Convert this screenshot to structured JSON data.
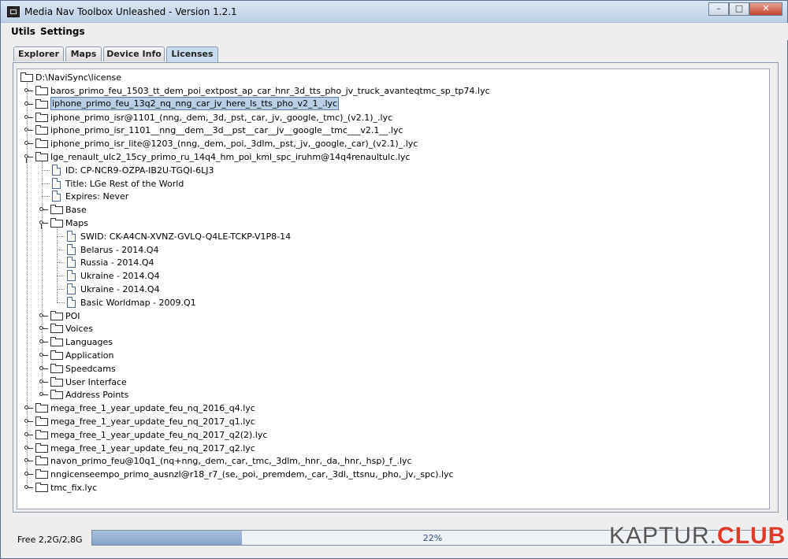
{
  "window": {
    "title": "Media Nav Toolbox Unleashed - Version 1.2.1",
    "controls": {
      "minimize": "–",
      "maximize": "□",
      "close": "✕"
    }
  },
  "menu": {
    "items": [
      "Utils",
      "Settings"
    ]
  },
  "tabs": {
    "items": [
      "Explorer",
      "Maps",
      "Device Info",
      "Licenses"
    ],
    "active": "Licenses"
  },
  "tree": {
    "root": "D:\\NaviSync\\license",
    "rows": [
      {
        "label": "baros_primo_feu_1503_tt_dem_poi_extpost_ap_car_hnr_3d_tts_pho_jv_truck_avanteqtmc_sp_tp74.lyc",
        "depth": 1,
        "icon": "folder",
        "state": "closed"
      },
      {
        "label": "iphone_primo_feu_13q2_nq_nng_car_jv_here_ls_tts_pho_v2_1_.lyc",
        "depth": 1,
        "icon": "folder",
        "state": "closed",
        "selected": true
      },
      {
        "label": "iphone_primo_isr@1101_(nng,_dem,_3d,_pst,_car,_jv,_google,_tmc)_(v2.1)_.lyc",
        "depth": 1,
        "icon": "folder",
        "state": "closed"
      },
      {
        "label": "iphone_primo_isr_1101__nng__dem__3d__pst__car__jv__google__tmc___v2.1__.lyc",
        "depth": 1,
        "icon": "folder",
        "state": "closed"
      },
      {
        "label": "iphone_primo_isr_lite@1203_(nng,_dem,_poi,_3dlm,_pst,_jv,_google,_car)_(v2.1)_.lyc",
        "depth": 1,
        "icon": "folder",
        "state": "closed"
      },
      {
        "label": "lge_renault_ulc2_15cy_primo_ru_14q4_hm_poi_kml_spc_iruhm@14q4renaultulc.lyc",
        "depth": 1,
        "icon": "folder",
        "state": "open"
      },
      {
        "label": "ID: CP-NCR9-OZPA-IB2U-TGQI-6LJ3",
        "depth": 2,
        "icon": "file"
      },
      {
        "label": "Title: LGe Rest of the World",
        "depth": 2,
        "icon": "file"
      },
      {
        "label": "Expires: Never",
        "depth": 2,
        "icon": "file"
      },
      {
        "label": "Base",
        "depth": 2,
        "icon": "folder",
        "state": "closed"
      },
      {
        "label": "Maps",
        "depth": 2,
        "icon": "folder",
        "state": "open"
      },
      {
        "label": "SWID: CK-A4CN-XVNZ-GVLQ-Q4LE-TCKP-V1P8-14",
        "depth": 3,
        "icon": "file"
      },
      {
        "label": "Belarus - 2014.Q4",
        "depth": 3,
        "icon": "file"
      },
      {
        "label": "Russia - 2014.Q4",
        "depth": 3,
        "icon": "file"
      },
      {
        "label": "Ukraine - 2014.Q4",
        "depth": 3,
        "icon": "file"
      },
      {
        "label": "Ukraine - 2014.Q4",
        "depth": 3,
        "icon": "file"
      },
      {
        "label": "Basic Worldmap - 2009.Q1",
        "depth": 3,
        "icon": "file"
      },
      {
        "label": "POI",
        "depth": 2,
        "icon": "folder",
        "state": "closed"
      },
      {
        "label": "Voices",
        "depth": 2,
        "icon": "folder",
        "state": "closed"
      },
      {
        "label": "Languages",
        "depth": 2,
        "icon": "folder",
        "state": "closed"
      },
      {
        "label": "Application",
        "depth": 2,
        "icon": "folder",
        "state": "closed"
      },
      {
        "label": "Speedcams",
        "depth": 2,
        "icon": "folder",
        "state": "closed"
      },
      {
        "label": "User Interface",
        "depth": 2,
        "icon": "folder",
        "state": "closed"
      },
      {
        "label": "Address Points",
        "depth": 2,
        "icon": "folder",
        "state": "closed"
      },
      {
        "label": "mega_free_1_year_update_feu_nq_2016_q4.lyc",
        "depth": 1,
        "icon": "folder",
        "state": "closed"
      },
      {
        "label": "mega_free_1_year_update_feu_nq_2017_q1.lyc",
        "depth": 1,
        "icon": "folder",
        "state": "closed"
      },
      {
        "label": "mega_free_1_year_update_feu_nq_2017_q2(2).lyc",
        "depth": 1,
        "icon": "folder",
        "state": "closed"
      },
      {
        "label": "mega_free_1_year_update_feu_nq_2017_q2.lyc",
        "depth": 1,
        "icon": "folder",
        "state": "closed"
      },
      {
        "label": "navon_primo_feu@10q1_(nq+nng,_dem,_car,_tmc,_3dlm,_hnr,_da,_hnr,_hsp)_f_.lyc",
        "depth": 1,
        "icon": "folder",
        "state": "closed"
      },
      {
        "label": "nngicenseempo_primo_ausnzl@r18_r7_(se,_poi,_premdem,_car,_3dl,_ttsnu,_pho,_jv,_spc).lyc",
        "depth": 1,
        "icon": "folder",
        "state": "closed"
      },
      {
        "label": "tmc_fix.lyc",
        "depth": 1,
        "icon": "folder",
        "state": "closed"
      }
    ]
  },
  "status": {
    "free_label": "Free 2,2G/2,8G",
    "progress_text": "22%",
    "progress_fraction": 0.22
  },
  "watermark": {
    "part1": "KAPTUR.",
    "part2": "CLUB"
  }
}
